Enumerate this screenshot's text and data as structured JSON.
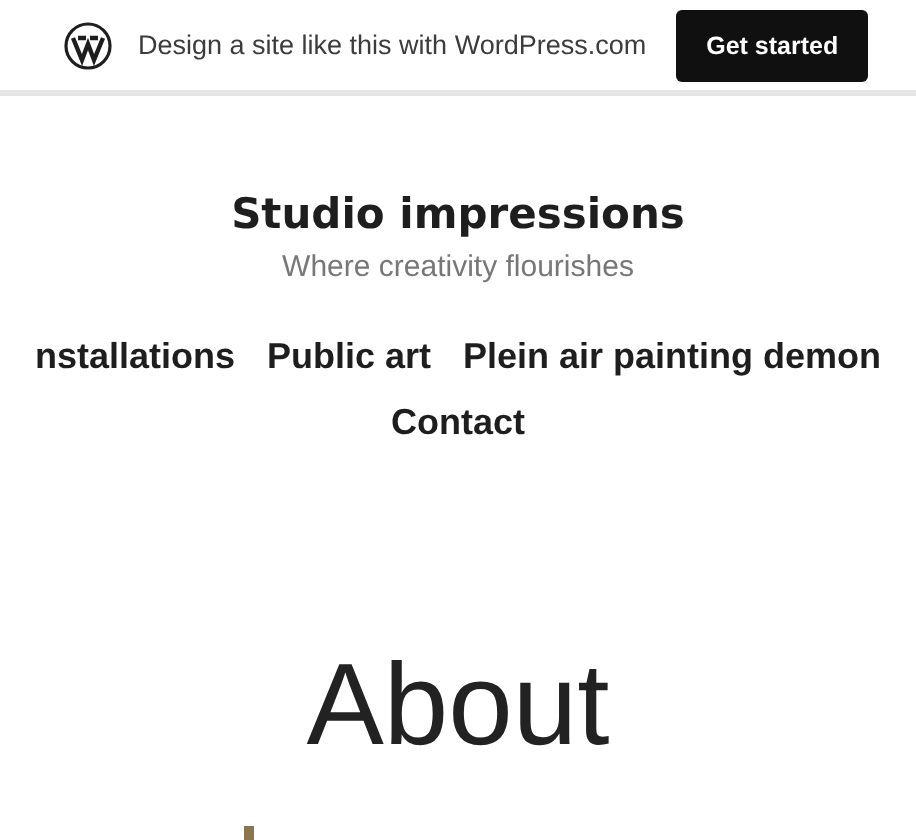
{
  "banner": {
    "text": "Design a site like this with WordPress.com",
    "button": "Get started"
  },
  "site": {
    "title": "Studio impressions",
    "tagline": "Where creativity flourishes"
  },
  "nav": {
    "rows": [
      [
        "nstallations",
        "Public art",
        "Plein air painting demon"
      ],
      [
        "Contact"
      ]
    ]
  },
  "page": {
    "heading": "About"
  }
}
